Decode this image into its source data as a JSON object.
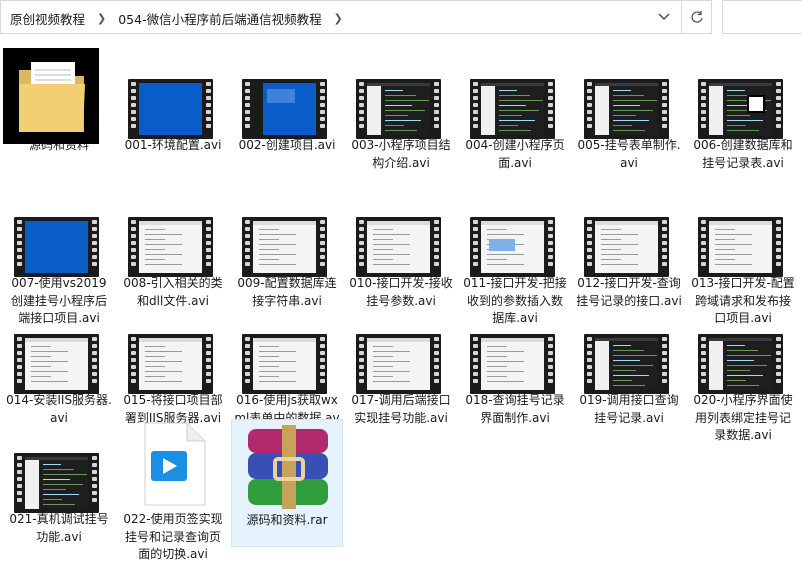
{
  "breadcrumb": [
    "原创视频教程",
    "054-微信小程序前后端通信视频教程"
  ],
  "items": [
    {
      "label": "源码和资料",
      "icon": "folder-icon"
    },
    {
      "label": "001-环境配置.avi",
      "thumb": "blue"
    },
    {
      "label": "002-创建项目.avi",
      "thumb": "blue-ui"
    },
    {
      "label": "003-小程序项目结构介绍.avi",
      "thumb": "dark"
    },
    {
      "label": "004-创建小程序页面.avi",
      "thumb": "dark"
    },
    {
      "label": "005-挂号表单制作.avi",
      "thumb": "dark"
    },
    {
      "label": "006-创建数据库和挂号记录表.avi",
      "thumb": "dark-qr"
    },
    {
      "label": "007-使用vs2019创建挂号小程序后端接口项目.avi",
      "thumb": "blue"
    },
    {
      "label": "008-引入相关的类和dll文件.avi",
      "thumb": "light"
    },
    {
      "label": "009-配置数据库连接字符串.avi",
      "thumb": "light"
    },
    {
      "label": "010-接口开发-接收挂号参数.avi",
      "thumb": "light"
    },
    {
      "label": "011-接口开发-把接收到的参数插入数据库.avi",
      "thumb": "light-blue"
    },
    {
      "label": "012-接口开发-查询挂号记录的接口.avi",
      "thumb": "light"
    },
    {
      "label": "013-接口开发-配置跨域请求和发布接口项目.avi",
      "thumb": "light"
    },
    {
      "label": "014-安装IIS服务器.avi",
      "thumb": "light"
    },
    {
      "label": "015-将接口项目部署到IIS服务器.avi",
      "thumb": "light"
    },
    {
      "label": "016-使用js获取wxml表单中的数据.avi",
      "thumb": "light"
    },
    {
      "label": "017-调用后端接口实现挂号功能.avi",
      "thumb": "light"
    },
    {
      "label": "018-查询挂号记录界面制作.avi",
      "thumb": "light"
    },
    {
      "label": "019-调用接口查询挂号记录.avi",
      "thumb": "dark"
    },
    {
      "label": "020-小程序界面使用列表绑定挂号记录数据.avi",
      "thumb": "dark"
    },
    {
      "label": "021-真机调试挂号功能.avi",
      "thumb": "dark"
    },
    {
      "label": "022-使用页签实现挂号和记录查询页面的切换.avi",
      "icon": "video-file-icon"
    },
    {
      "label": "源码和资料.rar",
      "icon": "winrar-archive-icon"
    }
  ],
  "colors": {
    "selection": "#e5f3ff",
    "film": "#1b1b1b",
    "accent_blue": "#0a5cc9"
  }
}
